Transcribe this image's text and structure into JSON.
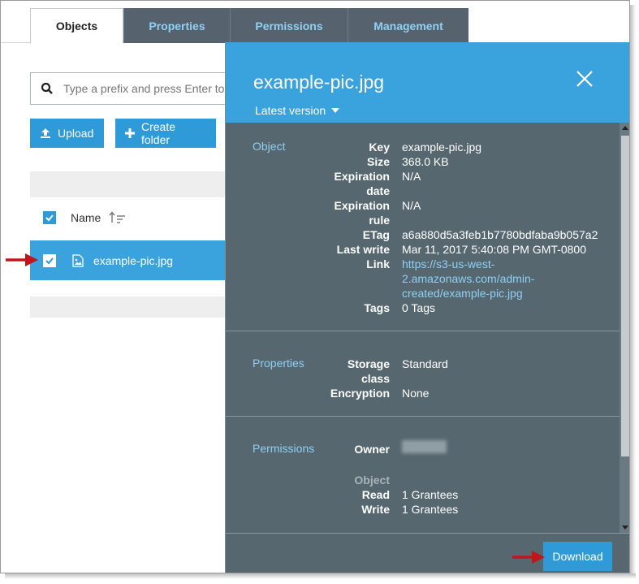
{
  "tabs": [
    {
      "label": "Objects"
    },
    {
      "label": "Properties"
    },
    {
      "label": "Permissions"
    },
    {
      "label": "Management"
    }
  ],
  "search": {
    "placeholder": "Type a prefix and press Enter to search"
  },
  "toolbar": {
    "upload_label": "Upload",
    "create_folder_label": "Create folder"
  },
  "table": {
    "name_header": "Name",
    "rows": [
      {
        "name": "example-pic.jpg",
        "selected": true
      }
    ]
  },
  "panel": {
    "title": "example-pic.jpg",
    "version_label": "Latest version",
    "object_section": {
      "label": "Object",
      "key_label": "Key",
      "key_value": "example-pic.jpg",
      "size_label": "Size",
      "size_value": "368.0 KB",
      "exp_date_label_1": "Expiration",
      "exp_date_label_2": "date",
      "exp_date_value": "N/A",
      "exp_rule_label_1": "Expiration",
      "exp_rule_label_2": "rule",
      "exp_rule_value": "N/A",
      "etag_label": "ETag",
      "etag_value": "a6a880d5a3feb1b7780bdfaba9b057a2",
      "last_write_label": "Last write",
      "last_write_value": "Mar 11, 2017 5:40:08 PM GMT-0800",
      "link_label": "Link",
      "link_line_1": "https://s3-us-west-",
      "link_line_2": "2.amazonaws.com/admin-",
      "link_line_3": "created/example-pic.jpg",
      "tags_label": "Tags",
      "tags_value": "0 Tags"
    },
    "properties_section": {
      "label": "Properties",
      "storage_label_1": "Storage",
      "storage_label_2": "class",
      "storage_value": "Standard",
      "encryption_label": "Encryption",
      "encryption_value": "None"
    },
    "permissions_section": {
      "label": "Permissions",
      "owner_label": "Owner",
      "object_label": "Object",
      "read_label": "Read",
      "read_value": "1 Grantees",
      "write_label": "Write",
      "write_value": "1 Grantees"
    },
    "download_label": "Download"
  },
  "colors": {
    "accent": "#2e9bd8",
    "panel_bg": "#56676f",
    "header_blue": "#3aa2dc",
    "link": "#8fd0f5",
    "arrow": "#c0161b"
  }
}
